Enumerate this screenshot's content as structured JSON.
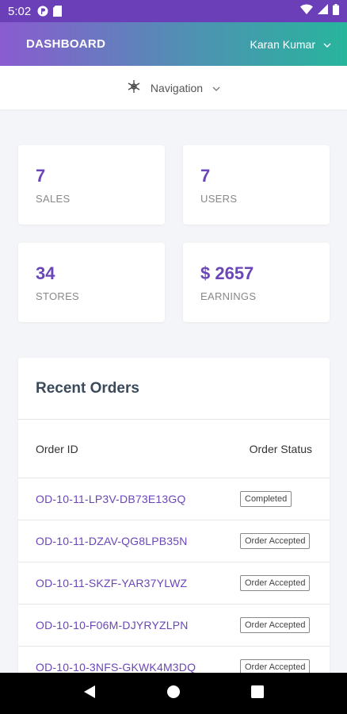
{
  "status_bar": {
    "time": "5:02"
  },
  "header": {
    "title": "DASHBOARD",
    "user_name": "Karan Kumar"
  },
  "nav": {
    "label": "Navigation"
  },
  "stats": [
    {
      "value": "7",
      "label": "SALES"
    },
    {
      "value": "7",
      "label": "USERS"
    },
    {
      "value": "34",
      "label": "STORES"
    },
    {
      "value": "$ 2657",
      "label": "EARNINGS"
    }
  ],
  "orders": {
    "title": "Recent Orders",
    "col_id": "Order ID",
    "col_status": "Order Status",
    "rows": [
      {
        "id": "OD-10-11-LP3V-DB73E13GQ",
        "status": "Completed"
      },
      {
        "id": "OD-10-11-DZAV-QG8LPB35N",
        "status": "Order Accepted"
      },
      {
        "id": "OD-10-11-SKZF-YAR37YLWZ",
        "status": "Order Accepted"
      },
      {
        "id": "OD-10-10-F06M-DJYRYZLPN",
        "status": "Order Accepted"
      },
      {
        "id": "OD-10-10-3NFS-GKWK4M3DQ",
        "status": "Order Accepted"
      }
    ]
  },
  "colors": {
    "accent": "#6a46b8",
    "status_bar": "#6a3fb8"
  }
}
